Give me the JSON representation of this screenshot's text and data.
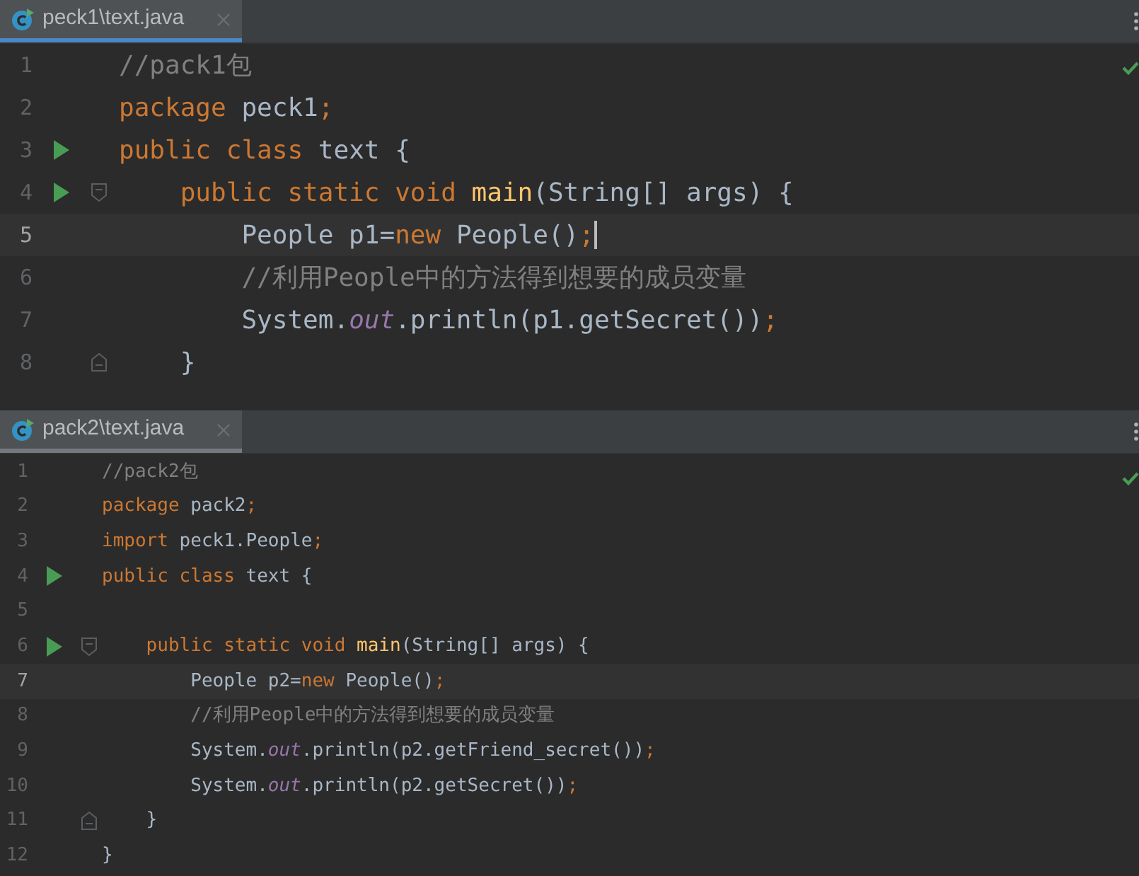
{
  "panes": [
    {
      "focused": true,
      "tab": {
        "label": "peck1\\text.java",
        "selected": true
      },
      "lines": [
        {
          "number": "1",
          "current": false,
          "caret": false,
          "run": false,
          "fold_open": false,
          "fold_close": false,
          "tokens": [
            {
              "kind": "comment",
              "text": "//pack1包"
            }
          ]
        },
        {
          "number": "2",
          "current": false,
          "caret": false,
          "run": false,
          "fold_open": false,
          "fold_close": false,
          "tokens": [
            {
              "kind": "keyword",
              "text": "package "
            },
            {
              "kind": "plain",
              "text": "peck1"
            },
            {
              "kind": "keyword",
              "text": ";"
            }
          ]
        },
        {
          "number": "3",
          "current": false,
          "caret": false,
          "run": true,
          "fold_open": false,
          "fold_close": false,
          "tokens": [
            {
              "kind": "keyword",
              "text": "public class "
            },
            {
              "kind": "plain",
              "text": "text {"
            }
          ]
        },
        {
          "number": "4",
          "current": false,
          "caret": false,
          "run": true,
          "fold_open": true,
          "fold_close": false,
          "tokens": [
            {
              "kind": "keyword",
              "text": "    public static void "
            },
            {
              "kind": "method",
              "text": "main"
            },
            {
              "kind": "plain",
              "text": "(String[] args) {"
            }
          ]
        },
        {
          "number": "5",
          "current": true,
          "caret": true,
          "run": false,
          "fold_open": false,
          "fold_close": false,
          "tokens": [
            {
              "kind": "plain",
              "text": "        People p1="
            },
            {
              "kind": "keyword",
              "text": "new "
            },
            {
              "kind": "plain",
              "text": "People()"
            },
            {
              "kind": "keyword",
              "text": ";"
            }
          ]
        },
        {
          "number": "6",
          "current": false,
          "caret": false,
          "run": false,
          "fold_open": false,
          "fold_close": false,
          "tokens": [
            {
              "kind": "comment",
              "text": "        //利用People中的方法得到想要的成员变量"
            }
          ]
        },
        {
          "number": "7",
          "current": false,
          "caret": false,
          "run": false,
          "fold_open": false,
          "fold_close": false,
          "tokens": [
            {
              "kind": "plain",
              "text": "        System."
            },
            {
              "kind": "static",
              "text": "out"
            },
            {
              "kind": "plain",
              "text": ".println(p1.getSecret())"
            },
            {
              "kind": "keyword",
              "text": ";"
            }
          ]
        },
        {
          "number": "8",
          "current": false,
          "caret": false,
          "run": false,
          "fold_open": false,
          "fold_close": true,
          "tokens": [
            {
              "kind": "plain",
              "text": "    }"
            }
          ]
        }
      ]
    },
    {
      "focused": false,
      "tab": {
        "label": "pack2\\text.java",
        "selected": true
      },
      "lines": [
        {
          "number": "1",
          "current": false,
          "caret": false,
          "run": false,
          "fold_open": false,
          "fold_close": false,
          "tokens": [
            {
              "kind": "comment",
              "text": "//pack2包"
            }
          ]
        },
        {
          "number": "2",
          "current": false,
          "caret": false,
          "run": false,
          "fold_open": false,
          "fold_close": false,
          "tokens": [
            {
              "kind": "keyword",
              "text": "package "
            },
            {
              "kind": "plain",
              "text": "pack2"
            },
            {
              "kind": "keyword",
              "text": ";"
            }
          ]
        },
        {
          "number": "3",
          "current": false,
          "caret": false,
          "run": false,
          "fold_open": false,
          "fold_close": false,
          "tokens": [
            {
              "kind": "keyword",
              "text": "import "
            },
            {
              "kind": "plain",
              "text": "peck1.People"
            },
            {
              "kind": "keyword",
              "text": ";"
            }
          ]
        },
        {
          "number": "4",
          "current": false,
          "caret": false,
          "run": true,
          "fold_open": false,
          "fold_close": false,
          "tokens": [
            {
              "kind": "keyword",
              "text": "public class "
            },
            {
              "kind": "plain",
              "text": "text {"
            }
          ]
        },
        {
          "number": "5",
          "current": false,
          "caret": false,
          "run": false,
          "fold_open": false,
          "fold_close": false
        },
        {
          "number": "6",
          "current": false,
          "caret": false,
          "run": true,
          "fold_open": true,
          "fold_close": false,
          "tokens": [
            {
              "kind": "keyword",
              "text": "    public static void "
            },
            {
              "kind": "method",
              "text": "main"
            },
            {
              "kind": "plain",
              "text": "(String[] args) {"
            }
          ]
        },
        {
          "number": "7",
          "current": true,
          "caret": false,
          "run": false,
          "fold_open": false,
          "fold_close": false,
          "tokens": [
            {
              "kind": "plain",
              "text": "        People p2="
            },
            {
              "kind": "keyword",
              "text": "new "
            },
            {
              "kind": "plain",
              "text": "People()"
            },
            {
              "kind": "keyword",
              "text": ";"
            }
          ]
        },
        {
          "number": "8",
          "current": false,
          "caret": false,
          "run": false,
          "fold_open": false,
          "fold_close": false,
          "tokens": [
            {
              "kind": "comment",
              "text": "        //利用People中的方法得到想要的成员变量"
            }
          ]
        },
        {
          "number": "9",
          "current": false,
          "caret": false,
          "run": false,
          "fold_open": false,
          "fold_close": false,
          "tokens": [
            {
              "kind": "plain",
              "text": "        System."
            },
            {
              "kind": "static",
              "text": "out"
            },
            {
              "kind": "plain",
              "text": ".println(p2.getFriend_secret())"
            },
            {
              "kind": "keyword",
              "text": ";"
            }
          ]
        },
        {
          "number": "10",
          "current": false,
          "caret": false,
          "run": false,
          "fold_open": false,
          "fold_close": false,
          "tokens": [
            {
              "kind": "plain",
              "text": "        System."
            },
            {
              "kind": "static",
              "text": "out"
            },
            {
              "kind": "plain",
              "text": ".println(p2.getSecret())"
            },
            {
              "kind": "keyword",
              "text": ";"
            }
          ]
        },
        {
          "number": "11",
          "current": false,
          "caret": false,
          "run": false,
          "fold_open": false,
          "fold_close": true,
          "tokens": [
            {
              "kind": "plain",
              "text": "    }"
            }
          ]
        },
        {
          "number": "12",
          "current": false,
          "caret": false,
          "run": false,
          "fold_open": false,
          "fold_close": false,
          "tokens": [
            {
              "kind": "plain",
              "text": "}"
            }
          ]
        }
      ]
    }
  ]
}
